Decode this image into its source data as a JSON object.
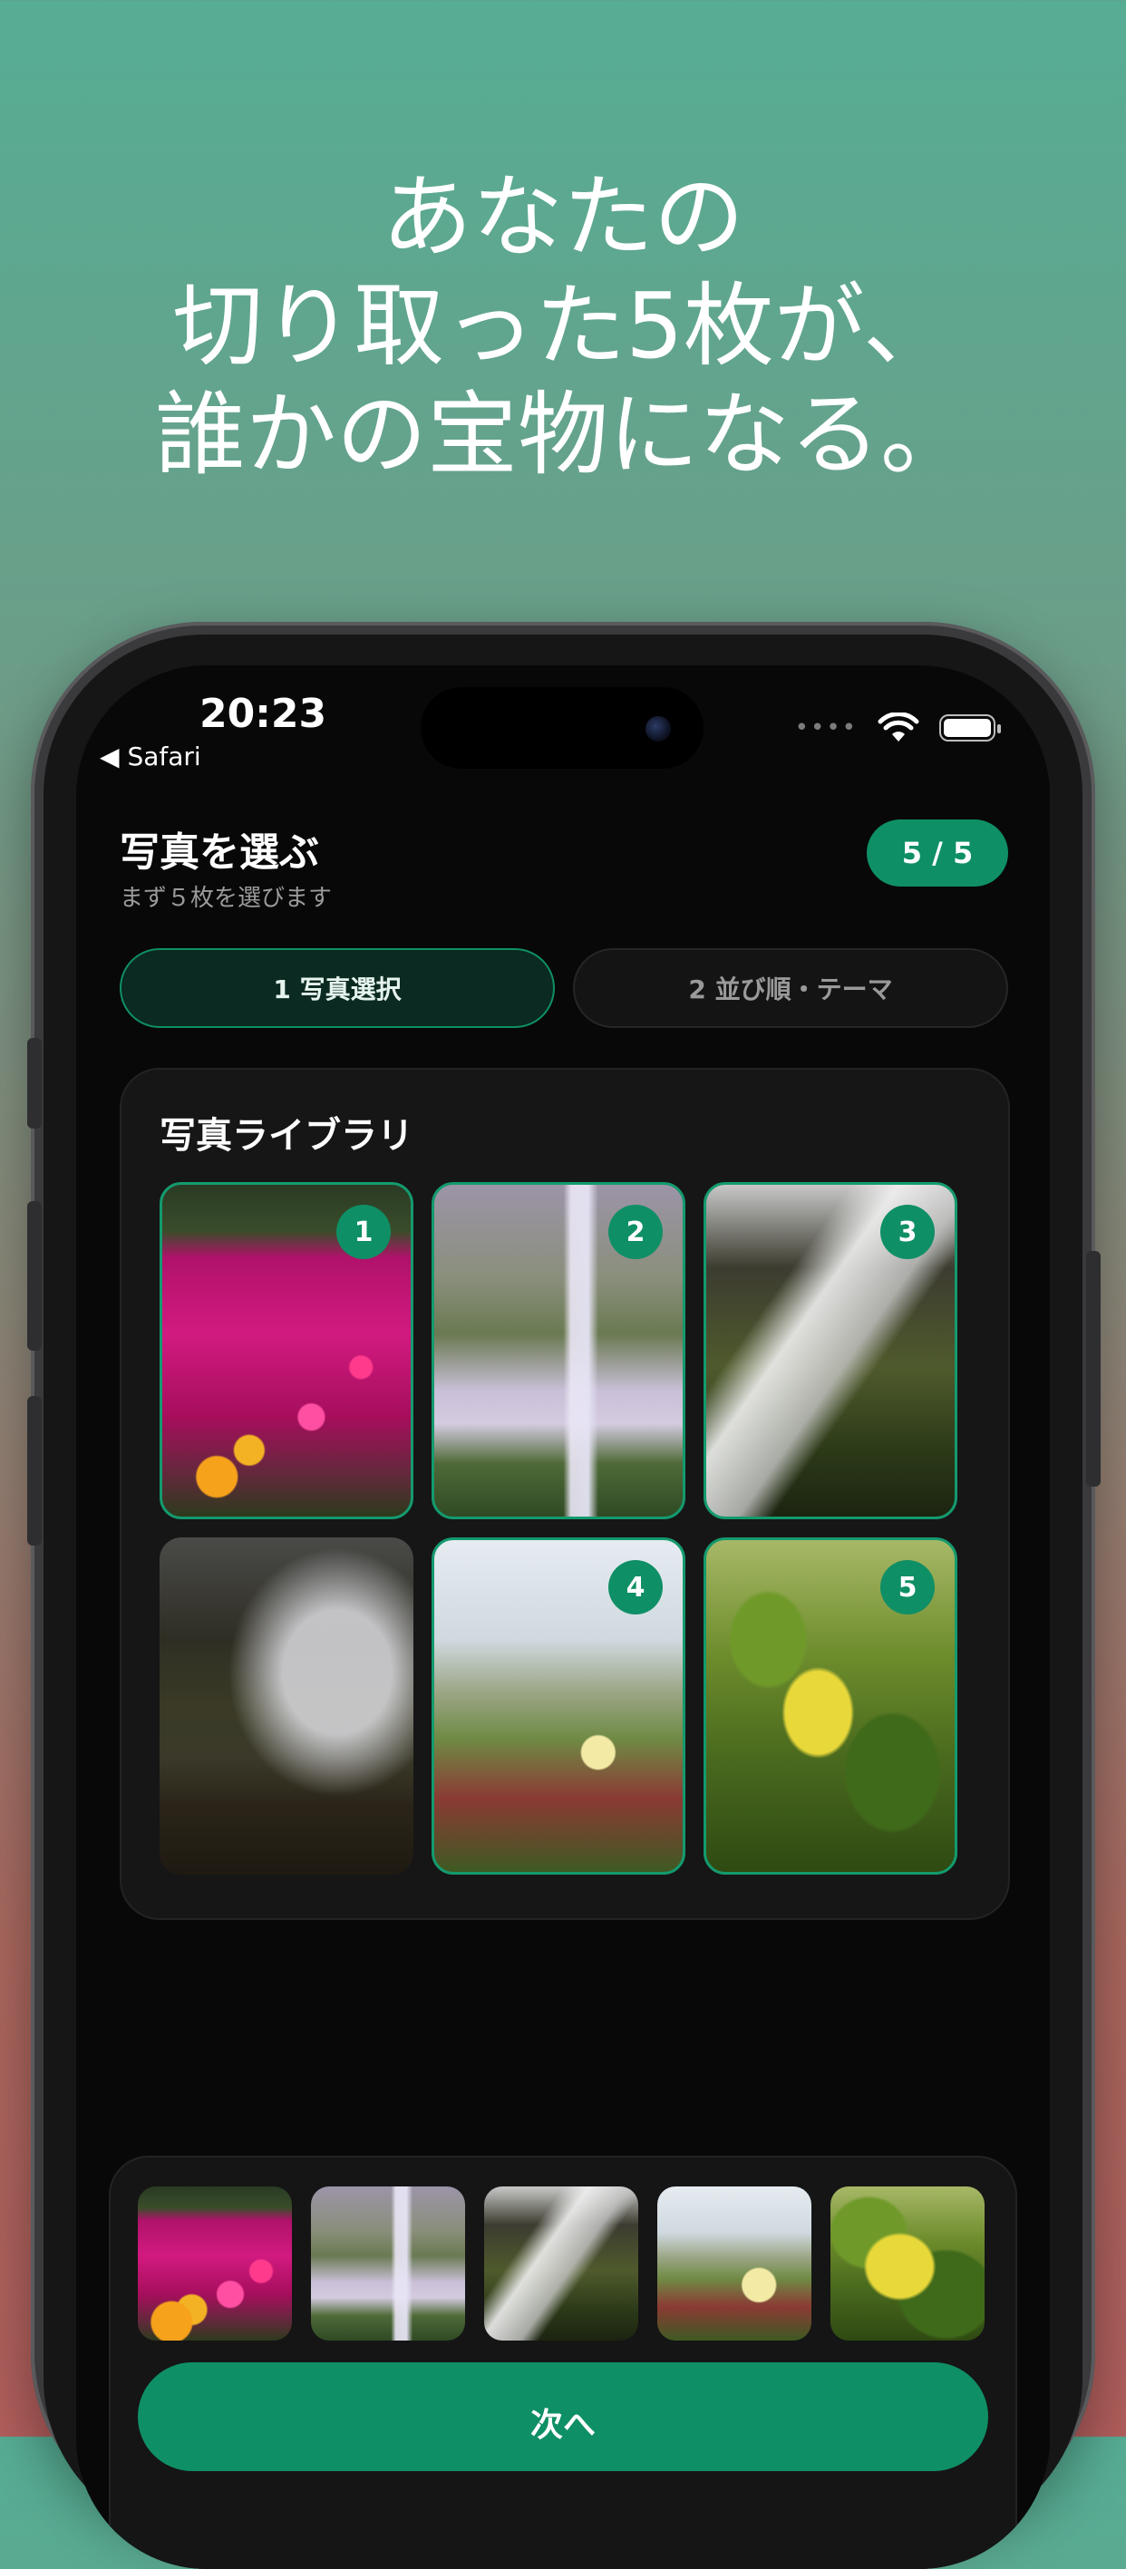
{
  "headline": {
    "line1": "あなたの",
    "line2": "切り取った5枚が、",
    "line3": "誰かの宝物になる。"
  },
  "status_bar": {
    "time": "20:23",
    "back_app": "Safari",
    "back_arrow": "◀"
  },
  "header": {
    "title": "写真を選ぶ",
    "subtitle": "まず５枚を選びます",
    "count": "5 / 5"
  },
  "steps": [
    {
      "label": "1 写真選択",
      "active": true
    },
    {
      "label": "2 並び順・テーマ",
      "active": false
    }
  ],
  "library": {
    "title": "写真ライブラリ",
    "photos": [
      {
        "subject": "pink-flowers",
        "badge": "1",
        "selected": true
      },
      {
        "subject": "waterfall-cliff",
        "badge": "2",
        "selected": true
      },
      {
        "subject": "waterfall-rocks",
        "badge": "3",
        "selected": true
      },
      {
        "subject": "waterfall-dark",
        "badge": "",
        "selected": false
      },
      {
        "subject": "ice-plant-flower",
        "badge": "4",
        "selected": true
      },
      {
        "subject": "green-leaves",
        "badge": "5",
        "selected": true
      }
    ]
  },
  "tray": {
    "selected": [
      "pink-flowers",
      "waterfall-cliff",
      "waterfall-rocks",
      "ice-plant-flower",
      "green-leaves"
    ],
    "next_label": "次へ"
  },
  "colors": {
    "accent": "#0f8f66",
    "background_top": "#56ad94",
    "background_bottom": "#b15e5c"
  },
  "icons": [
    "back-arrow-icon",
    "wifi-icon",
    "battery-icon",
    "cellular-dots-icon"
  ]
}
